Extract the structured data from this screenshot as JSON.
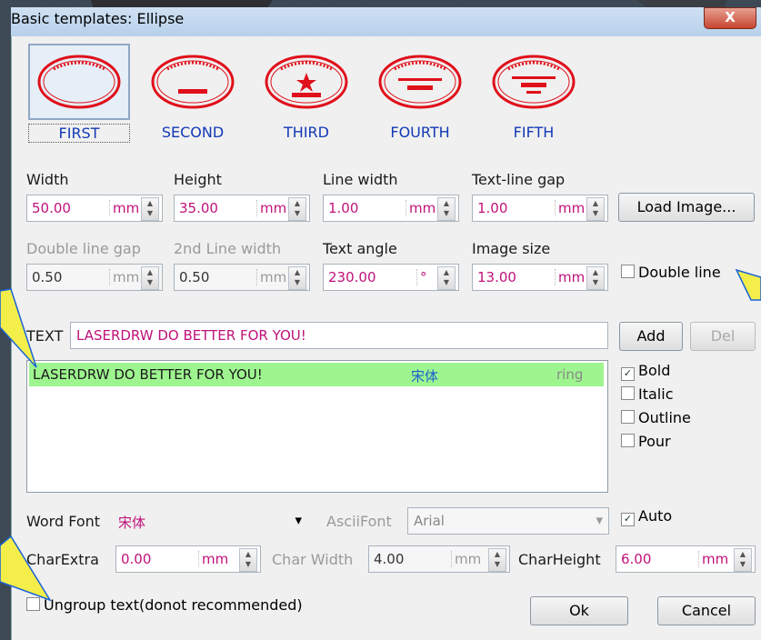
{
  "window": {
    "title": "Basic templates: Ellipse",
    "close_label": "X"
  },
  "templates": [
    {
      "label": "FIRST",
      "selected": true
    },
    {
      "label": "SECOND"
    },
    {
      "label": "THIRD"
    },
    {
      "label": "FOURTH"
    },
    {
      "label": "FIFTH"
    }
  ],
  "fields": {
    "width": {
      "label": "Width",
      "value": "50.00",
      "unit": "mm"
    },
    "height": {
      "label": "Height",
      "value": "35.00",
      "unit": "mm"
    },
    "line_width": {
      "label": "Line width",
      "value": "1.00",
      "unit": "mm"
    },
    "text_line_gap": {
      "label": "Text-line gap",
      "value": "1.00",
      "unit": "mm"
    },
    "double_line_gap": {
      "label": "Double line gap",
      "value": "0.50",
      "unit": "mm"
    },
    "second_line_width": {
      "label": "2nd Line width",
      "value": "0.50",
      "unit": "mm"
    },
    "text_angle": {
      "label": "Text angle",
      "value": "230.00",
      "unit": "°"
    },
    "image_size": {
      "label": "Image size",
      "value": "13.00",
      "unit": "mm"
    }
  },
  "buttons": {
    "load_image": "Load Image...",
    "add": "Add",
    "del": "Del",
    "ok": "Ok",
    "cancel": "Cancel"
  },
  "text_input": {
    "label": "TEXT",
    "value": "LASERDRW DO BETTER FOR YOU!"
  },
  "list": [
    {
      "text": "LASERDRW DO BETTER FOR YOU!",
      "font": "宋体",
      "mode": "ring"
    }
  ],
  "checkboxes": {
    "double_line": {
      "label": "Double line",
      "checked": false
    },
    "bold": {
      "label": "Bold",
      "checked": true
    },
    "italic": {
      "label": "Italic",
      "checked": false
    },
    "outline": {
      "label": "Outline",
      "checked": false
    },
    "pour": {
      "label": "Pour",
      "checked": false
    },
    "auto": {
      "label": "Auto",
      "checked": true
    },
    "ungroup": {
      "label": "Ungroup text(donot recommended)",
      "checked": false
    }
  },
  "word_font": {
    "label": "Word Font",
    "value": "宋体"
  },
  "ascii_font": {
    "label": "AsciiFont",
    "value": "Arial"
  },
  "char_extra": {
    "label": "CharExtra",
    "value": "0.00",
    "unit": "mm"
  },
  "char_width": {
    "label": "Char Width",
    "value": "4.00",
    "unit": "mm"
  },
  "char_height": {
    "label": "CharHeight",
    "value": "6.00",
    "unit": "mm"
  },
  "glyphs": {
    "check": "✓",
    "up": "▲",
    "down": "▼",
    "dropdown": "▾"
  },
  "colors": {
    "value_text": "#c0127a",
    "template_label": "#1239b5",
    "list_selection": "#9ef58f",
    "stamp_red": "#e0101a",
    "callout": "#f4ee4a"
  }
}
